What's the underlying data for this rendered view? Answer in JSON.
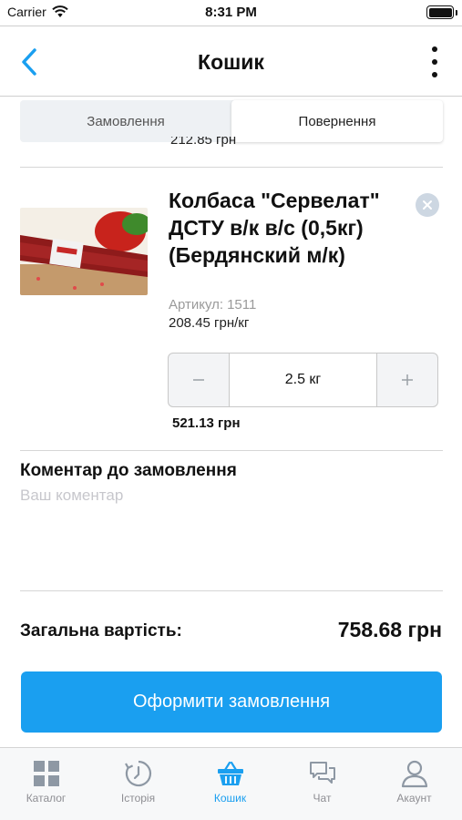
{
  "status_bar": {
    "carrier": "Carrier",
    "time": "8:31 PM"
  },
  "nav": {
    "title": "Кошик",
    "back_icon": "chevron-left-icon",
    "more_icon": "more-vertical-icon"
  },
  "segments": [
    {
      "label": "Замовлення",
      "selected": false
    },
    {
      "label": "Повернення",
      "selected": true
    }
  ],
  "previous_item_price_cut": "212.85 грн",
  "product": {
    "name": "Колбаса \"Сервелат\" ДСТУ в/к в/с (0,5кг) (Бердянский м/к)",
    "sku_label": "Артикул:",
    "sku": "1511",
    "unit_price": "208.45 грн/кг",
    "quantity": "2.5 кг",
    "line_total": "521.13 грн"
  },
  "comment": {
    "title": "Коментар до замовлення",
    "placeholder": "Ваш коментар"
  },
  "total": {
    "label": "Загальна вартість:",
    "value": "758.68 грн"
  },
  "checkout_label": "Оформити замовлення",
  "accent_color": "#1a9ff0",
  "tab_bar": [
    {
      "label": "Каталог",
      "icon": "grid-icon",
      "active": false
    },
    {
      "label": "Історія",
      "icon": "history-icon",
      "active": false
    },
    {
      "label": "Кошик",
      "icon": "basket-icon",
      "active": true
    },
    {
      "label": "Чат",
      "icon": "chat-icon",
      "active": false
    },
    {
      "label": "Акаунт",
      "icon": "user-icon",
      "active": false
    }
  ]
}
